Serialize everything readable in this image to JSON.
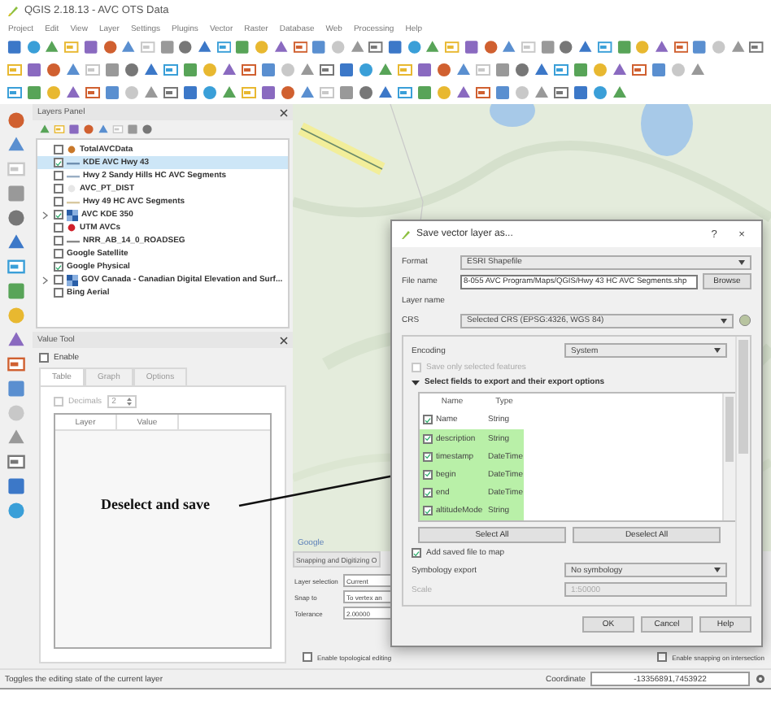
{
  "window": {
    "title": "QGIS 2.18.13 - AVC OTS Data"
  },
  "menu": [
    "Project",
    "Edit",
    "View",
    "Layer",
    "Settings",
    "Plugins",
    "Vector",
    "Raster",
    "Database",
    "Web",
    "Processing",
    "Help"
  ],
  "layers_panel": {
    "title": "Layers Panel",
    "layers": [
      {
        "name": "TotalAVCData",
        "kind": "point",
        "color": "#c8782a",
        "checked": false,
        "selected": false,
        "expander": false
      },
      {
        "name": "KDE AVC Hwy 43",
        "kind": "line",
        "color": "#6f8fb0",
        "checked": true,
        "selected": true,
        "expander": false
      },
      {
        "name": "Hwy 2 Sandy Hills HC AVC Segments",
        "kind": "line",
        "color": "#9aaec4",
        "checked": false,
        "selected": false,
        "expander": false
      },
      {
        "name": "AVC_PT_DIST",
        "kind": "point",
        "color": "#e6e6e6",
        "checked": false,
        "selected": false,
        "expander": false
      },
      {
        "name": "Hwy 49 HC AVC Segments",
        "kind": "line",
        "color": "#d8c9a0",
        "checked": false,
        "selected": false,
        "expander": false
      },
      {
        "name": "AVC KDE 350",
        "kind": "raster",
        "checked": true,
        "selected": false,
        "expander": true
      },
      {
        "name": "UTM AVCs",
        "kind": "point",
        "color": "#d0202a",
        "checked": false,
        "selected": false,
        "expander": false
      },
      {
        "name": "NRR_AB_14_0_ROADSEG",
        "kind": "line",
        "color": "#8a8a8a",
        "checked": false,
        "selected": false,
        "expander": false
      },
      {
        "name": "Google Satellite",
        "kind": "plain",
        "checked": false,
        "selected": false,
        "expander": false
      },
      {
        "name": "Google Physical",
        "kind": "plain",
        "checked": true,
        "selected": false,
        "expander": false
      },
      {
        "name": "GOV Canada - Canadian Digital Elevation and Surf...",
        "kind": "raster",
        "checked": false,
        "selected": false,
        "expander": true
      },
      {
        "name": "Bing Aerial",
        "kind": "plain",
        "checked": false,
        "selected": false,
        "expander": false
      }
    ]
  },
  "value_tool": {
    "title": "Value Tool",
    "enable": {
      "label": "Enable",
      "checked": false
    },
    "tabs": [
      {
        "label": "Table",
        "selected": true
      },
      {
        "label": "Graph",
        "selected": false
      },
      {
        "label": "Options",
        "selected": false
      }
    ],
    "decimals": {
      "label": "Decimals",
      "checked": false,
      "disabled": true,
      "value": "2"
    },
    "columns": [
      "Layer",
      "Value"
    ]
  },
  "annotation": {
    "text": "Deselect and save"
  },
  "map": {
    "attribution": "Google"
  },
  "snapping": {
    "title": "Snapping and Digitizing O",
    "rows": [
      {
        "label": "Layer selection",
        "value": "Current"
      },
      {
        "label": "Snap to",
        "value": "To vertex an"
      },
      {
        "label": "Tolerance",
        "value": "2.00000"
      }
    ],
    "topological": {
      "label": "Enable topological editing",
      "checked": false
    },
    "intersection": {
      "label": "Enable snapping on intersection",
      "checked": false
    }
  },
  "dialog": {
    "title": "Save vector layer as...",
    "help_glyph": "?",
    "close_glyph": "×",
    "format": {
      "label": "Format",
      "value": "ESRI Shapefile"
    },
    "file_name": {
      "label": "File name",
      "value": "8-055 AVC Program/Maps/QGIS/Hwy 43 HC AVC Segments.shp",
      "button": "Browse"
    },
    "layer_name": {
      "label": "Layer name"
    },
    "crs": {
      "label": "CRS",
      "value": "Selected CRS (EPSG:4326, WGS 84)"
    },
    "encoding": {
      "label": "Encoding",
      "value": "System"
    },
    "save_selected": {
      "label": "Save only selected features",
      "checked": false,
      "disabled": true
    },
    "fields_section": {
      "title": "Select fields to export and their export options",
      "expanded": true
    },
    "field_columns": [
      "Name",
      "Type"
    ],
    "fields": [
      {
        "name": "Name",
        "type": "String",
        "checked": true,
        "selected": false
      },
      {
        "name": "description",
        "type": "String",
        "checked": true,
        "selected": true
      },
      {
        "name": "timestamp",
        "type": "DateTime",
        "checked": true,
        "selected": true
      },
      {
        "name": "begin",
        "type": "DateTime",
        "checked": true,
        "selected": true
      },
      {
        "name": "end",
        "type": "DateTime",
        "checked": true,
        "selected": true
      },
      {
        "name": "altitudeMode",
        "type": "String",
        "checked": true,
        "selected": true
      }
    ],
    "select_all": "Select All",
    "deselect_all": "Deselect All",
    "add_to_map": {
      "label": "Add saved file to map",
      "checked": true
    },
    "symbology": {
      "label": "Symbology export",
      "value": "No symbology"
    },
    "scale": {
      "label": "Scale",
      "value": "1:50000",
      "disabled": true
    },
    "buttons": [
      "OK",
      "Cancel",
      "Help"
    ]
  },
  "status_bar": {
    "message": "Toggles the editing state of the current layer",
    "coordinate_label": "Coordinate",
    "coordinate": "-13356891,7453922"
  }
}
